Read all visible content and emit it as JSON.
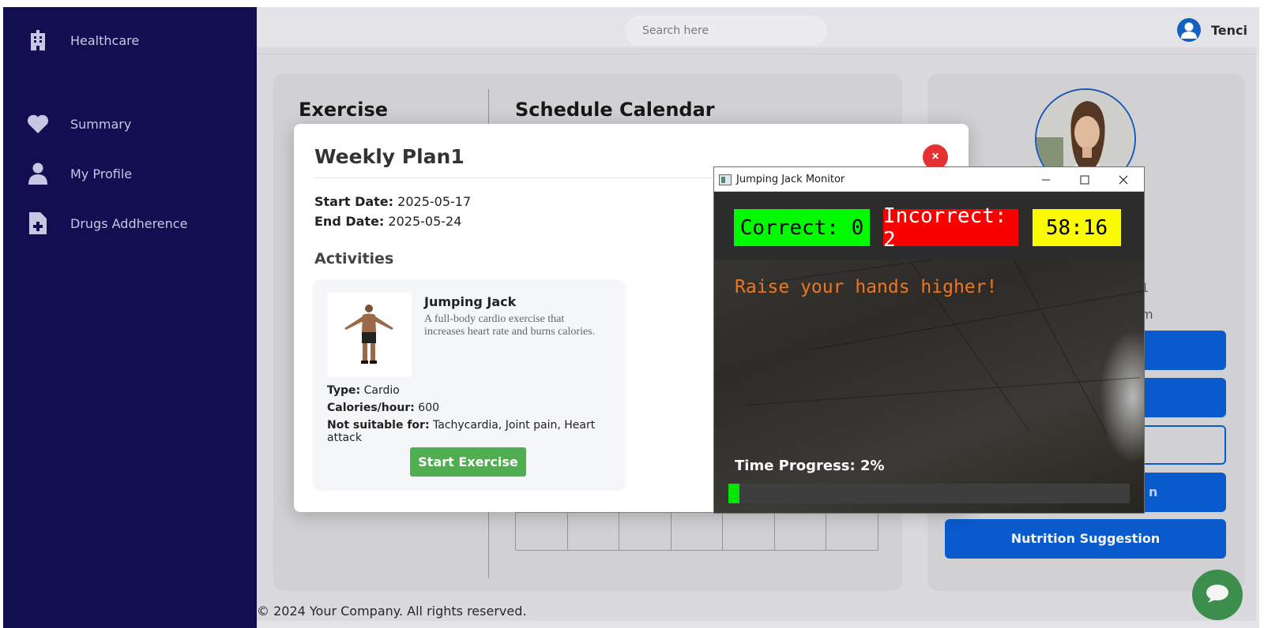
{
  "sidebar": {
    "brand": "Healthcare",
    "items": [
      {
        "label": "Summary",
        "icon": "heart-icon"
      },
      {
        "label": "My Profile",
        "icon": "user-icon"
      },
      {
        "label": "Drugs Addherence",
        "icon": "medical-file-icon"
      }
    ]
  },
  "header": {
    "search_placeholder": "Search here",
    "user_name": "Tenci"
  },
  "page": {
    "exercise_heading": "Exercise",
    "calendar_heading": "Schedule Calendar",
    "footer": "© 2024 Your Company. All rights reserved.",
    "right_panel": {
      "peek_text_1": "1",
      "peek_text_2": "m",
      "buttons": [
        "",
        "",
        "",
        "n",
        "Nutrition Suggestion"
      ]
    }
  },
  "modal": {
    "title": "Weekly Plan1",
    "close_label": "×",
    "start_date_label": "Start Date:",
    "start_date": "2025-05-17",
    "end_date_label": "End Date:",
    "end_date": "2025-05-24",
    "activities_heading": "Activities",
    "activity": {
      "name": "Jumping Jack",
      "description": "A full-body cardio exercise that increases heart rate and burns calories.",
      "type_label": "Type:",
      "type": "Cardio",
      "calories_label": "Calories/hour:",
      "calories": "600",
      "not_suitable_label": "Not suitable for:",
      "not_suitable": "Tachycardia, Joint pain, Heart attack",
      "start_button": "Start Exercise"
    }
  },
  "monitor": {
    "window_title": "Jumping Jack Monitor",
    "correct": "Correct: 0",
    "incorrect": "Incorrect: 2",
    "timer": "58:16",
    "feedback": "Raise your hands higher!",
    "progress_label": "Time Progress: 2%",
    "progress_fraction": 0.028
  },
  "colors": {
    "sidebar_bg": "#130e52",
    "primary_blue": "#0a5fd6",
    "start_green": "#4fae50",
    "close_red": "#e53131",
    "correct_green": "#00fa00",
    "incorrect_red": "#fa0000",
    "timer_yellow": "#fafa00",
    "feedback_orange": "#f07520"
  }
}
